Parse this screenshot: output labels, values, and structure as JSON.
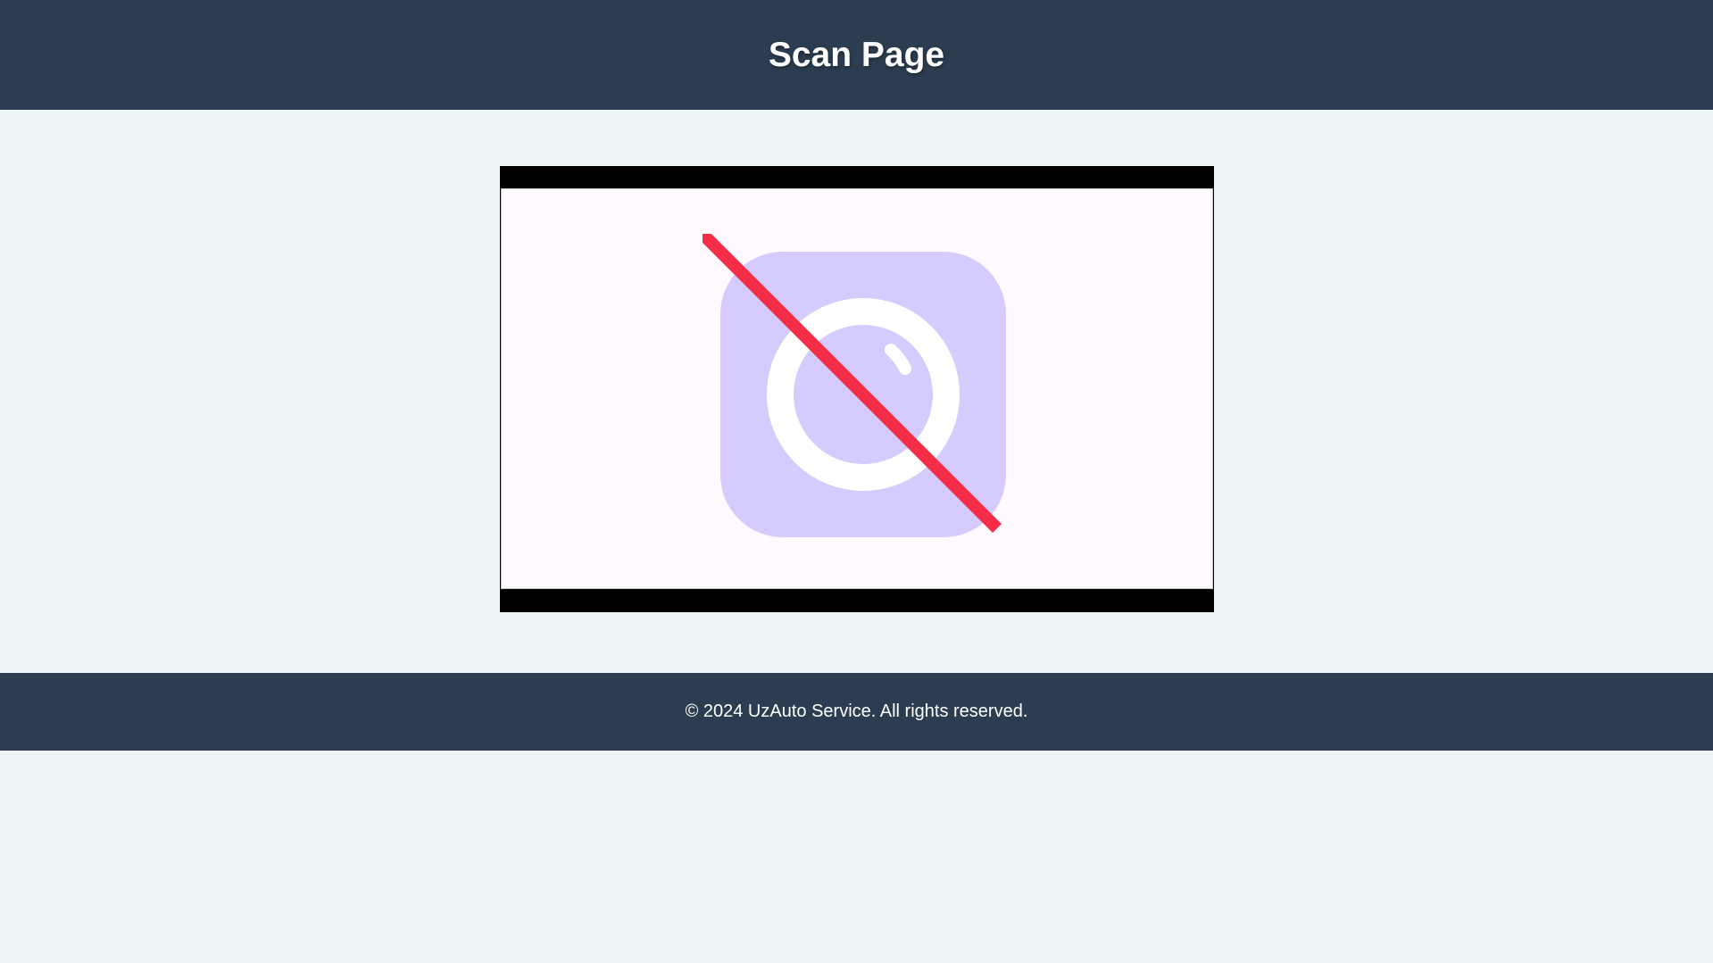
{
  "header": {
    "title": "Scan Page"
  },
  "scanner": {
    "icon": "camera-off-icon",
    "icon_color": "#d6cbfd",
    "slash_color": "#f52d46"
  },
  "footer": {
    "copyright": "© 2024 UzAuto Service. All rights reserved."
  },
  "colors": {
    "header_bg": "#2c3d51",
    "page_bg": "#eef5f9",
    "frame_bg": "#000000",
    "view_bg": "#fffaff"
  }
}
